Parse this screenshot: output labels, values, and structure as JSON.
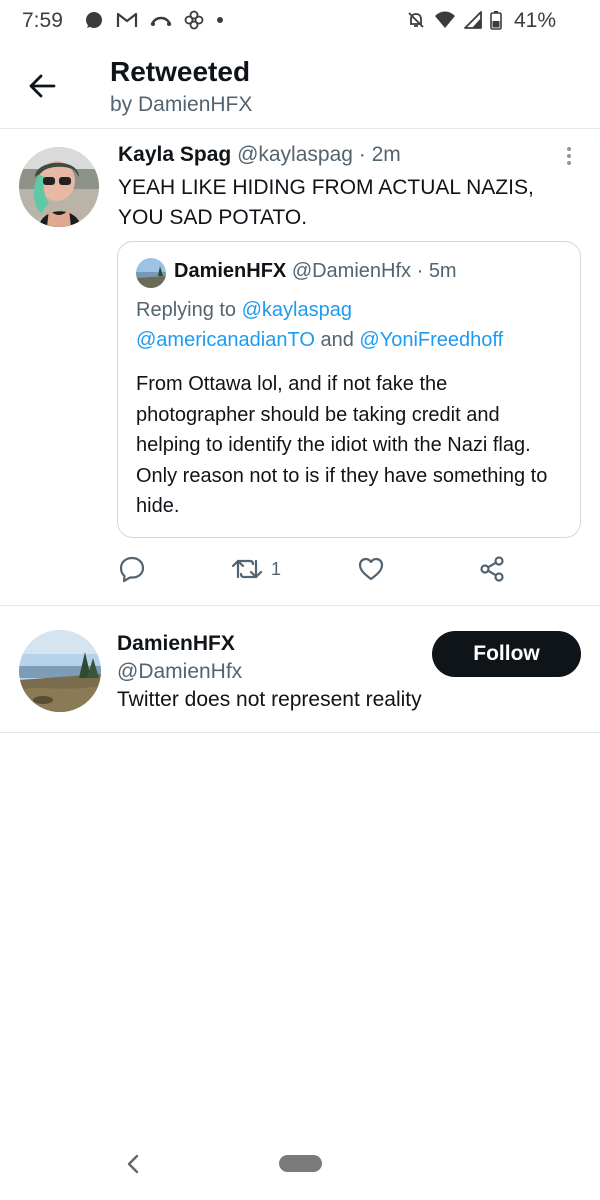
{
  "status_bar": {
    "time": "7:59",
    "battery": "41%",
    "left_icons": [
      "signal-messenger-icon",
      "gmail-icon",
      "missed-call-icon",
      "pinwheel-icon",
      "dot-icon"
    ],
    "right_icons": [
      "notifications-off-icon",
      "wifi-icon",
      "cell-signal-icon",
      "battery-icon"
    ]
  },
  "header": {
    "title": "Retweeted",
    "subtitle": "by DamienHFX"
  },
  "tweet": {
    "author_name": "Kayla Spag",
    "author_handle": "@kaylaspag",
    "separator": " · ",
    "time": "2m",
    "text": "YEAH LIKE HIDING FROM ACTUAL NAZIS, YOU SAD POTATO.",
    "quoted": {
      "author_name": "DamienHFX",
      "author_handle": "@DamienHfx",
      "separator": " · ",
      "time": "5m",
      "replying_prefix": "Replying to ",
      "reply_to_1": "@kaylaspag",
      "reply_to_2": "@americanadianTO",
      "reply_and": " and ",
      "reply_to_3": "@YoniFreedhoff",
      "text": "From Ottawa lol, and if not fake the photographer should be taking credit and helping to identify the idiot with the Nazi flag. Only reason not to is if they have something to hide."
    },
    "actions": {
      "reply_icon": "reply-icon",
      "retweet_icon": "retweet-icon",
      "retweet_count": "1",
      "like_icon": "heart-icon",
      "share_icon": "share-icon"
    }
  },
  "user_card": {
    "name": "DamienHFX",
    "handle": "@DamienHfx",
    "bio": "Twitter does not represent reality",
    "follow_label": "Follow"
  },
  "colors": {
    "text": "#0f1419",
    "muted": "#536471",
    "link": "#1d9bf0",
    "border": "#cfd9de",
    "follow_bg": "#0f1419"
  }
}
